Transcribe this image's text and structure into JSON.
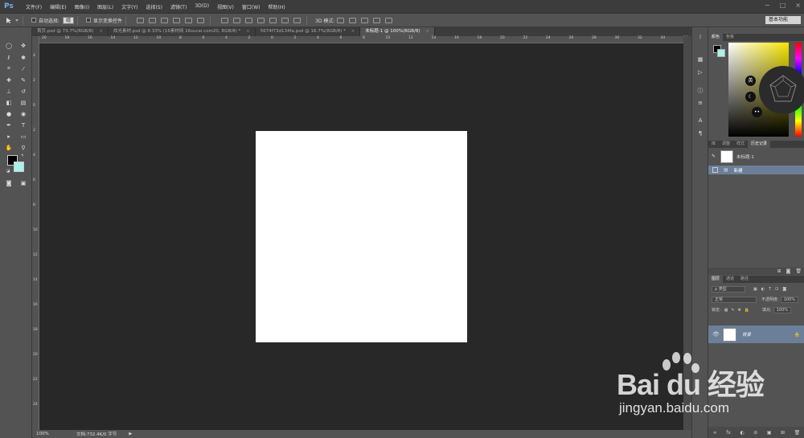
{
  "app": {
    "logo": "Ps"
  },
  "menubar": {
    "items": [
      "文件(F)",
      "编辑(E)",
      "图像(I)",
      "图层(L)",
      "文字(Y)",
      "选择(S)",
      "滤镜(T)",
      "3D(D)",
      "视图(V)",
      "窗口(W)",
      "帮助(H)"
    ]
  },
  "window_controls": {
    "minimize": "−",
    "maximize": "□",
    "close": "×"
  },
  "options": {
    "auto_select_label": "自动选择:",
    "auto_select_value": "组",
    "show_transform_label": "显示变换控件",
    "mode_3d_label": "3D 模式:"
  },
  "workspace": {
    "label": "基本功能"
  },
  "tabs": [
    {
      "label": "首页.psd @ 73.7%(RGB/8)"
    },
    {
      "label": "炫光素材.psd @ 8.33% (16素材网 16sucai.com20, RGB/8) *"
    },
    {
      "label": "5674f73d134fa.psd @ 16.7%(RGB/8) *"
    },
    {
      "label": "未标题-1 @ 100%(RGB/8)"
    }
  ],
  "tab_close": "×",
  "ruler": {
    "top": [
      "20",
      "18",
      "16",
      "14",
      "12",
      "10",
      "8",
      "6",
      "4",
      "2",
      "0",
      "2",
      "4",
      "6",
      "8",
      "10",
      "12",
      "14",
      "16",
      "18",
      "20",
      "22",
      "24",
      "26",
      "28",
      "30",
      "32",
      "34",
      "36"
    ],
    "left": [
      "4",
      "2",
      "0",
      "2",
      "4",
      "6",
      "8",
      "10",
      "12",
      "14",
      "16",
      "18",
      "20",
      "22",
      "24"
    ]
  },
  "statusbar": {
    "zoom": "100%",
    "doc_info": "文档:732.4K/0 字节",
    "arrow": "▶"
  },
  "color_panel": {
    "tabs": [
      "颜色",
      "色板"
    ]
  },
  "ime": {
    "lang": "英",
    "moon": "☾",
    "dots": "••"
  },
  "history_panel": {
    "tabs": [
      "库",
      "调整",
      "样式",
      "历史记录"
    ],
    "snapshot_name": "未标题-1",
    "state_name": "新建"
  },
  "layers_panel": {
    "tabs": [
      "图层",
      "通道",
      "路径"
    ],
    "filter_label": "ρ 类型",
    "blend_mode": "正常",
    "opacity_label": "不透明度:",
    "opacity_value": "100%",
    "lock_label": "锁定:",
    "fill_label": "填充:",
    "fill_value": "100%",
    "layer_name": "背景",
    "footer_icons": [
      "∞",
      "fx",
      "◐",
      "⊘",
      "▣",
      "⊞",
      "🗑"
    ]
  },
  "watermark": {
    "brand": "Bai du 经验",
    "url": "jingyan.baidu.com"
  },
  "colors": {
    "fg": "#000000",
    "bg": "#a9f1ee",
    "canvas_bg": "#282828",
    "selection": "#6b7f99"
  }
}
